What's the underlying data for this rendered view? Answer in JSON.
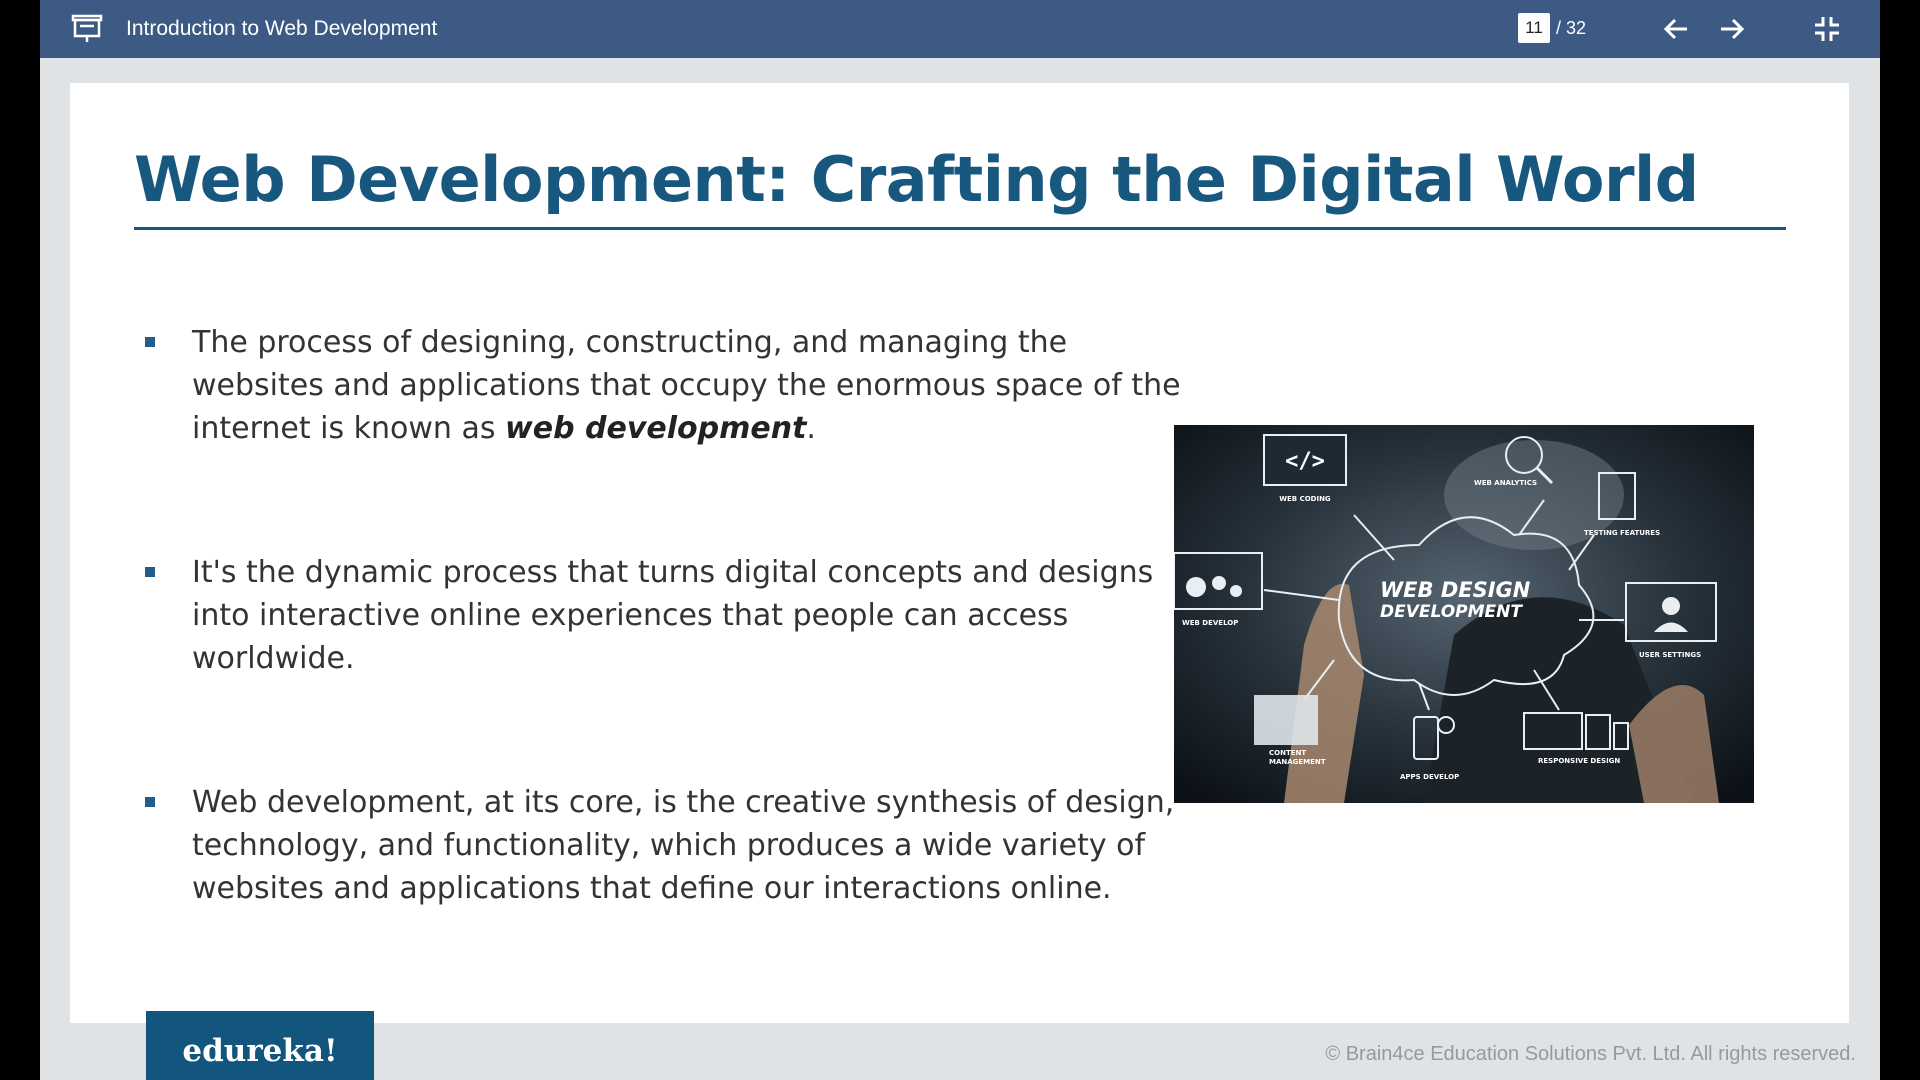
{
  "topbar": {
    "title": "Introduction to Web Development",
    "current_page": "11",
    "total_pages": "/ 32",
    "icons": [
      "presentation-icon",
      "arrow-left-icon",
      "arrow-right-icon",
      "exit-fullscreen-icon"
    ]
  },
  "slide": {
    "title": "Web Development: Crafting the Digital World",
    "bullets": [
      {
        "before": "The process of designing, constructing, and managing the websites and applications that occupy the enormous space of the internet is known as ",
        "emphasis": "web development",
        "after": "."
      },
      {
        "before": "It's the dynamic process that turns digital concepts and designs into interactive online experiences that people can access worldwide.",
        "emphasis": "",
        "after": ""
      },
      {
        "before": "Web development, at its core, is the creative synthesis of design, technology, and functionality, which produces a wide variety of websites and applications that define our interactions online.",
        "emphasis": "",
        "after": ""
      }
    ],
    "image": {
      "center_line1": "WEB DESIGN",
      "center_line2": "DEVELOPMENT",
      "labels": {
        "web_coding": "WEB CODING",
        "web_analytics": "WEB ANALYTICS",
        "testing_features": "TESTING FEATURES",
        "web_develop": "WEB DEVELOP",
        "user_settings": "USER SETTINGS",
        "content_management_1": "CONTENT",
        "content_management_2": "MANAGEMENT",
        "apps_develop": "APPS DEVELOP",
        "responsive_design": "RESPONSIVE DESIGN"
      },
      "code_glyph": "</>"
    }
  },
  "footer": {
    "logo": "edureka!",
    "copyright": "© Brain4ce Education Solutions Pvt. Ltd. All rights reserved."
  },
  "colors": {
    "topbar": "#3c5a84",
    "title": "#19587e",
    "logo_bg": "#12567e"
  }
}
